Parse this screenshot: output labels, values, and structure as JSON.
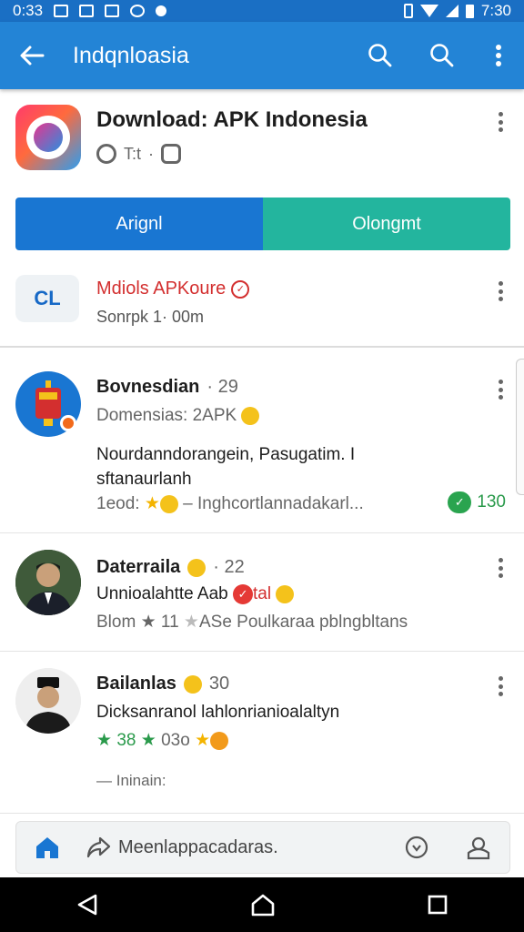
{
  "status_bar": {
    "time_left": "0:33",
    "time_right": "7:30"
  },
  "app_bar": {
    "title": "Indqnloasia"
  },
  "app_header": {
    "name": "Download: APK Indonesia",
    "meta_text": "T:t"
  },
  "buttons": {
    "primary": "Arignl",
    "secondary": "Olongmt"
  },
  "publisher": {
    "logo_text": "CL",
    "name": "Mdiols APKoure",
    "subtitle": "Sonrpk 1· 00m"
  },
  "feed": [
    {
      "author": "Bovnesdian",
      "count": "· 29",
      "subline": "Domensias: 2APK",
      "body": "Nourdanndorangein, Pasugatim. I sftanaurlanh",
      "footer": "1eod: ",
      "footer_text": " – Inghcortlannadakarl...",
      "likes": "130"
    },
    {
      "author": "Daterraila",
      "count": "· 22",
      "line1": "Unnioalahtte Aab",
      "line1_tail": "tal",
      "footer": "Blom ",
      "footer_text": "11 ",
      "footer_text2": "ASe Poulkaraa pblngbltans"
    },
    {
      "author": "Bailanlas",
      "count": "30",
      "line1": "Dicksanranol lahlonrianioalaltyn",
      "r1": "38",
      "r2": "03o",
      "tail": "— Ininain:"
    }
  ],
  "bottom_nav": {
    "label": "Meenlappacadaras."
  },
  "colors": {
    "appbar": "#2384d6",
    "status_bar": "#1a6fc4",
    "primary_button": "#1976d2",
    "secondary_button": "#23b59e",
    "publisher_name": "#d32f2f"
  }
}
